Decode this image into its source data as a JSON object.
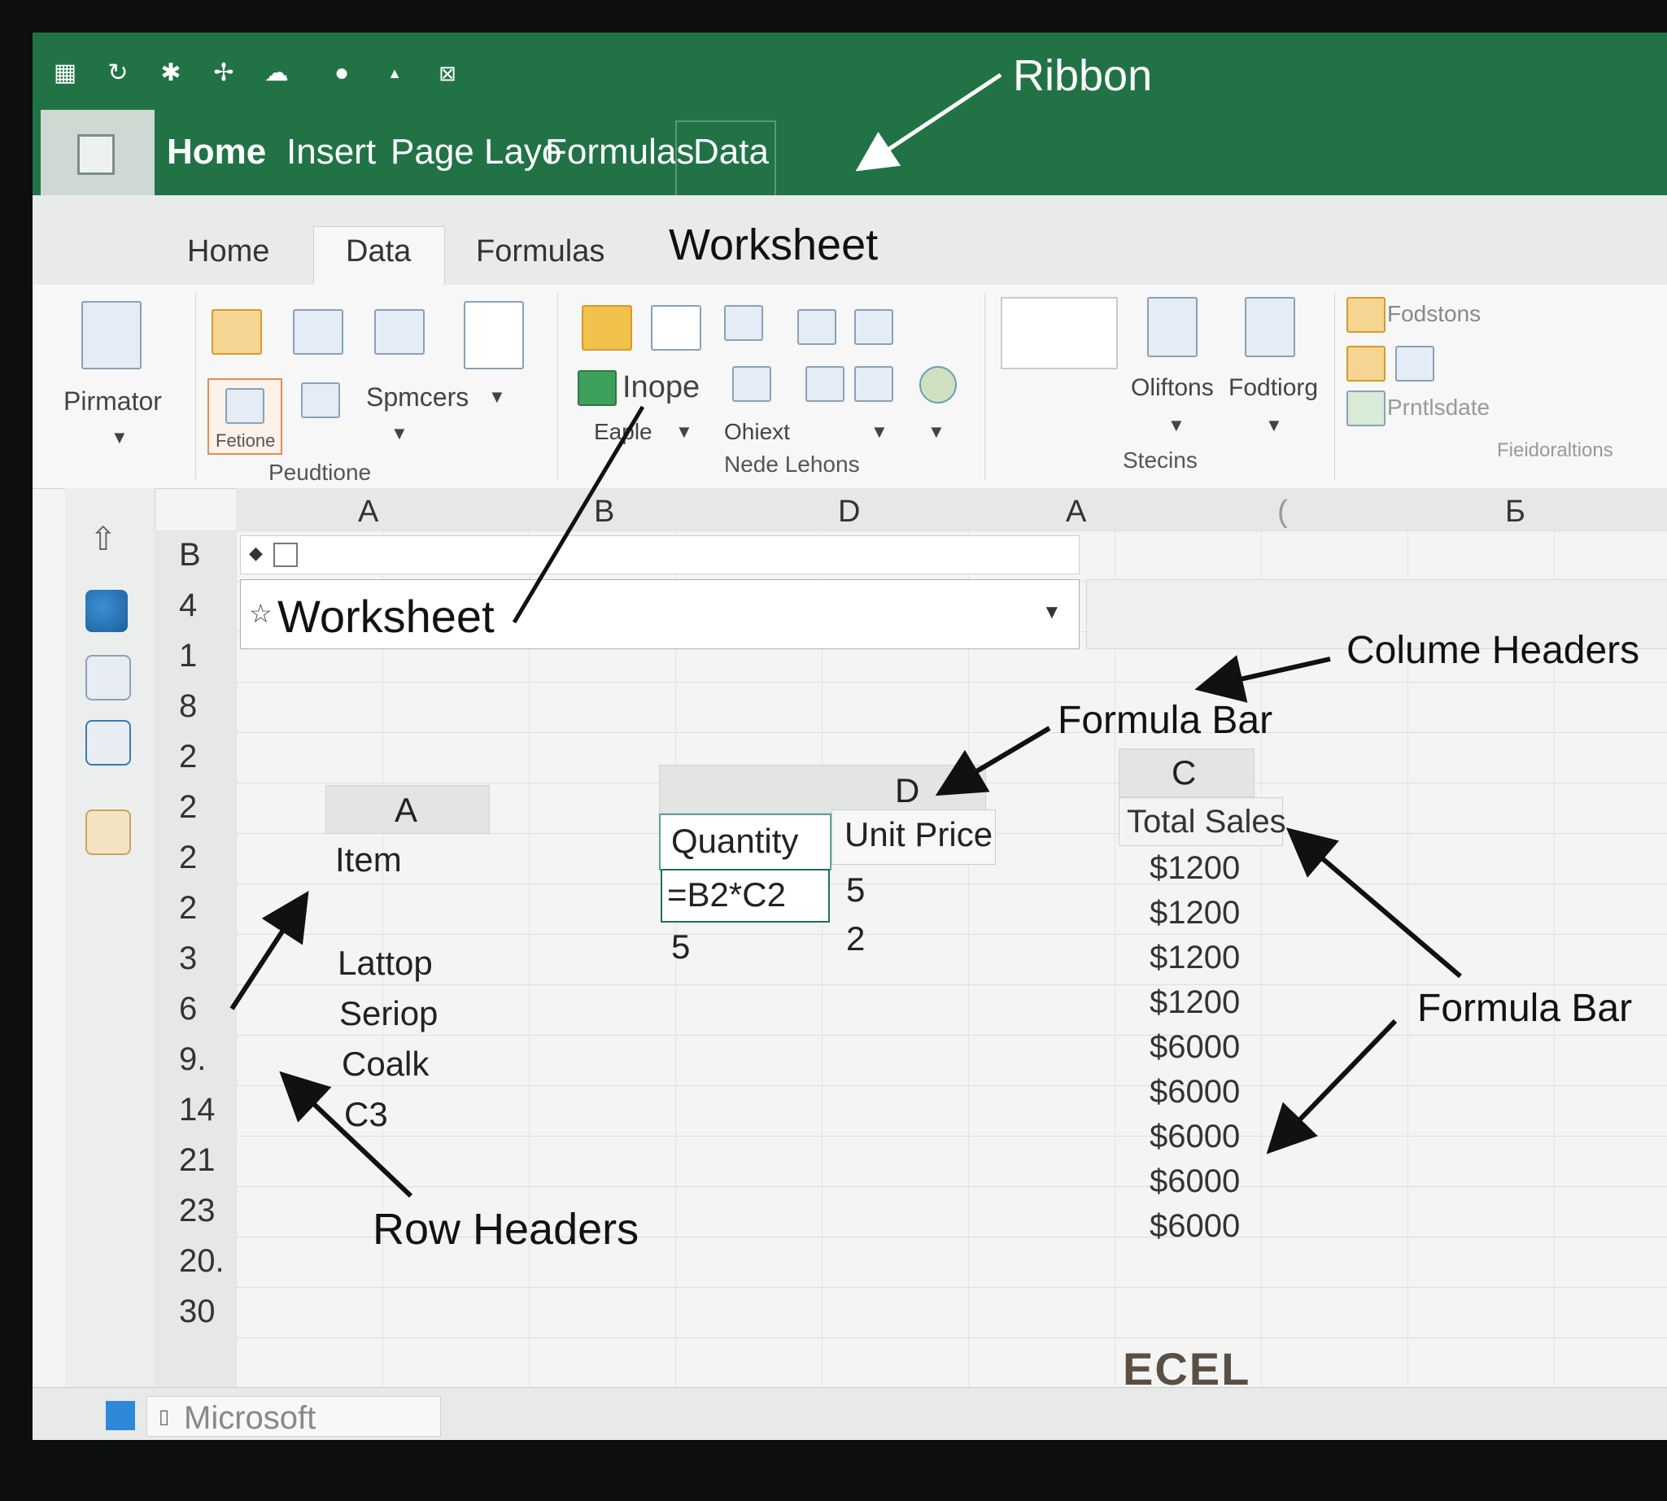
{
  "qat": {
    "icons": [
      "grid-icon",
      "refresh-icon",
      "sparkle-icon",
      "pin-icon",
      "cloud-icon",
      "chat-icon",
      "dot-icon",
      "close-box-icon"
    ]
  },
  "tabs": {
    "home": "Home",
    "insert": "Insert",
    "page_layout": "Page Layo",
    "formulas": "Formulas",
    "data": "Data"
  },
  "subtabs": {
    "home": "Home",
    "data": "Data",
    "formulas": "Formulas"
  },
  "ribbon": {
    "pirmator": "Pirmator",
    "fetione": "Fetione",
    "spmcers": "Spmcers",
    "group1": "Peudtione",
    "inope": "Inope",
    "eaple": "Eaple",
    "ohiext": "Ohiext",
    "group2": "Nede Lehons",
    "oliftons": "Oliftons",
    "fodtiorg": "Fodtiorg",
    "group3": "Stecins",
    "fodstons": "Fodstons",
    "prntlsdate": "Prntlsdate",
    "group4": "Fieidoraltions"
  },
  "column_headers": [
    "A",
    "B",
    "D",
    "A",
    "(",
    "Б"
  ],
  "row_headers": [
    "B",
    "4",
    "1",
    "8",
    "2",
    "2",
    "2",
    "2",
    "3",
    "6",
    "9.",
    "14",
    "21",
    "23",
    "20.",
    "30"
  ],
  "formula_bar": {
    "name": "Worksheet"
  },
  "table": {
    "col_a": "A",
    "col_d": "D",
    "col_c": "C",
    "item_header": "Item",
    "items": [
      "Lattop",
      "Seriop",
      "Coalk",
      "C3"
    ],
    "quantity_header": "Quantity",
    "unit_price_header": "Unit Price",
    "quantity_values": [
      "=B2*C2",
      "5"
    ],
    "unit_price_values": [
      "5",
      "2"
    ],
    "total_sales_header": "Total Sales",
    "total_sales": [
      "$1200",
      "$1200",
      "$1200",
      "$1200",
      "$6000",
      "$6000",
      "$6000",
      "$6000",
      "$6000"
    ]
  },
  "callouts": {
    "ribbon": "Ribbon",
    "worksheet_top": "Worksheet",
    "column_headers": "Colume Headers",
    "formula_bar_1": "Formula Bar",
    "formula_bar_2": "Formula Bar",
    "row_headers": "Row Headers"
  },
  "taskbar": {
    "app": "Microsoft"
  },
  "bezel": {
    "brand": "ECEL"
  },
  "colors": {
    "ribbon_green": "#217346",
    "arrow": "#111111"
  }
}
